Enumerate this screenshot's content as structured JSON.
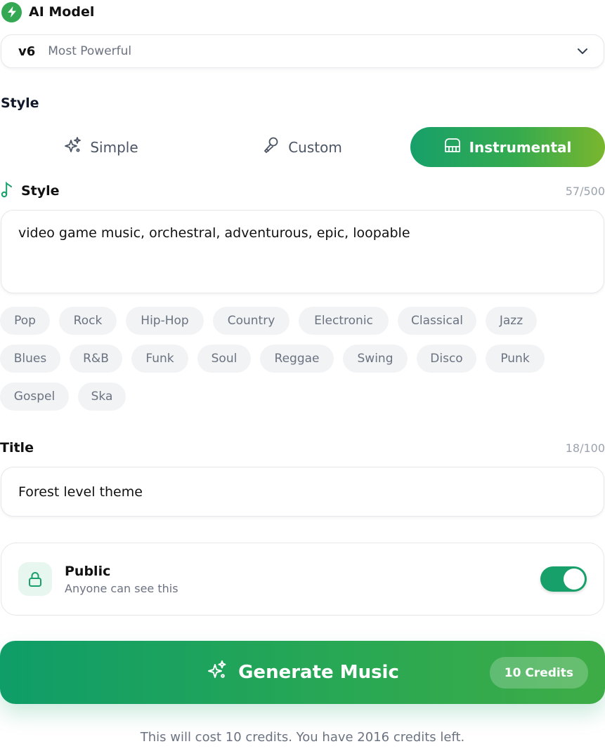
{
  "ai_model": {
    "label": "AI Model",
    "version": "v6",
    "description": "Most Powerful"
  },
  "style_section": {
    "heading": "Style",
    "tabs": [
      {
        "label": "Simple",
        "icon": "sparkles-icon",
        "active": false
      },
      {
        "label": "Custom",
        "icon": "microphone-icon",
        "active": false
      },
      {
        "label": "Instrumental",
        "icon": "piano-icon",
        "active": true
      }
    ]
  },
  "style_field": {
    "label": "Style",
    "count": "57/500",
    "value": "video game music, orchestral, adventurous, epic, loopable"
  },
  "genres": [
    "Pop",
    "Rock",
    "Hip-Hop",
    "Country",
    "Electronic",
    "Classical",
    "Jazz",
    "Blues",
    "R&B",
    "Funk",
    "Soul",
    "Reggae",
    "Swing",
    "Disco",
    "Punk",
    "Gospel",
    "Ska"
  ],
  "title_field": {
    "label": "Title",
    "count": "18/100",
    "value": "Forest level theme"
  },
  "visibility": {
    "title": "Public",
    "subtitle": "Anyone can see this",
    "enabled": true
  },
  "generate": {
    "label": "Generate Music",
    "credits_badge": "10 Credits"
  },
  "cost_note": "This will cost 10 credits. You have 2016 credits left.",
  "colors": {
    "accent": "#17a06a",
    "accent_light": "#7ab62e",
    "chip_bg": "#f1f3f5",
    "muted_text": "#6b7280"
  }
}
